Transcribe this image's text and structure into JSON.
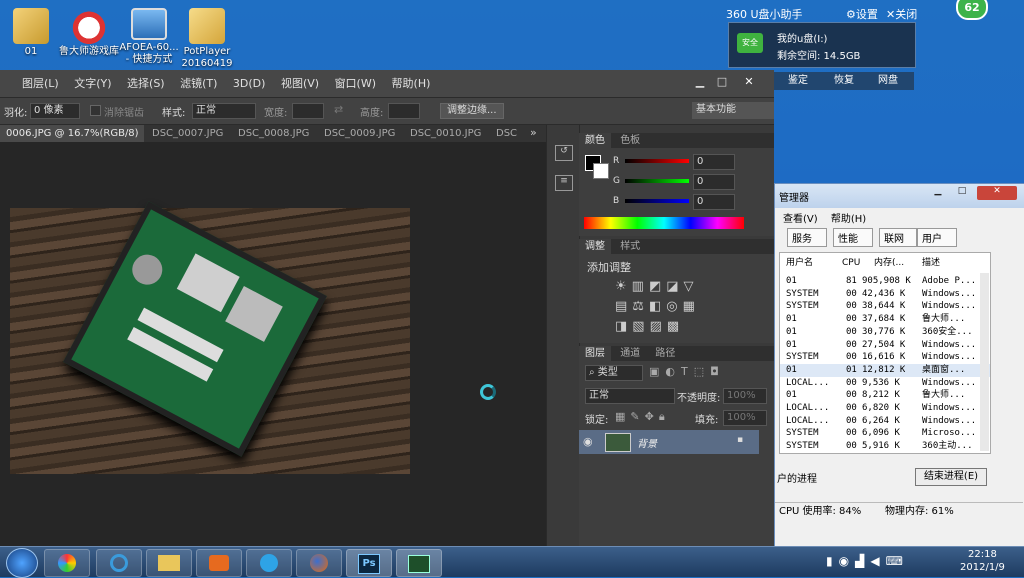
{
  "desktop": {
    "icons": [
      {
        "label": "01",
        "icon": "user-folder-icon"
      },
      {
        "label": "鲁大师游戏库",
        "icon": "gamepad-icon"
      },
      {
        "label": "AFOEA-60... - 快捷方式",
        "icon": "monitor-shortcut-icon"
      },
      {
        "label": "PotPlayer 20160419",
        "icon": "folder-icon"
      }
    ]
  },
  "widget360": {
    "title": "360 U盘小助手",
    "settings": "设置",
    "close": "关闭",
    "badge": "62",
    "safe": "安全",
    "drive_name": "我的u盘(I:)",
    "free_space": "剩余空间: 14.5GB",
    "actions": [
      "鉴定",
      "恢复",
      "网盘"
    ]
  },
  "photoshop": {
    "menu": [
      "图层(L)",
      "文字(Y)",
      "选择(S)",
      "滤镜(T)",
      "3D(D)",
      "视图(V)",
      "窗口(W)",
      "帮助(H)"
    ],
    "options": {
      "feather_label": "羽化:",
      "feather_value": "0 像素",
      "antialias": "消除锯齿",
      "style_label": "样式:",
      "style_value": "正常",
      "width_label": "宽度:",
      "height_label": "高度:",
      "refine_edge": "调整边缘...",
      "workspace": "基本功能"
    },
    "doc_tabs": [
      "0006.JPG @ 16.7%(RGB/8) *",
      "DSC_0007.JPG",
      "DSC_0008.JPG",
      "DSC_0009.JPG",
      "DSC_0010.JPG",
      "DSC"
    ],
    "color_panel": {
      "tabs": [
        "颜色",
        "色板"
      ],
      "r_label": "R",
      "g_label": "G",
      "b_label": "B",
      "r": "0",
      "g": "0",
      "b": "0"
    },
    "adjust_panel": {
      "tabs": [
        "调整",
        "样式"
      ],
      "title": "添加调整"
    },
    "layers_panel": {
      "tabs": [
        "图层",
        "通道",
        "路径"
      ],
      "kind": "类型",
      "blend": "正常",
      "opacity_label": "不透明度:",
      "opacity_value": "100%",
      "lock_label": "锁定:",
      "fill_label": "填充:",
      "fill_value": "100%",
      "layer_name": "背景"
    }
  },
  "taskmgr": {
    "title": "管理器",
    "menu": [
      "查看(V)",
      "帮助(H)"
    ],
    "tabs": [
      "服务",
      "性能",
      "联网",
      "用户"
    ],
    "columns": [
      "用户名",
      "CPU",
      "内存(...",
      "描述"
    ],
    "rows": [
      [
        "01",
        "81",
        "905,908 K",
        "Adobe P..."
      ],
      [
        "SYSTEM",
        "00",
        "42,436 K",
        "Windows..."
      ],
      [
        "SYSTEM",
        "00",
        "38,644 K",
        "Windows..."
      ],
      [
        "01",
        "00",
        "37,684 K",
        "鲁大师..."
      ],
      [
        "01",
        "00",
        "30,776 K",
        "360安全..."
      ],
      [
        "01",
        "00",
        "27,504 K",
        "Windows..."
      ],
      [
        "SYSTEM",
        "00",
        "16,616 K",
        "Windows..."
      ],
      [
        "01",
        "01",
        "12,812 K",
        "桌面窗..."
      ],
      [
        "LOCAL...",
        "00",
        "9,536 K",
        "Windows..."
      ],
      [
        "01",
        "00",
        "8,212 K",
        "鲁大师..."
      ],
      [
        "LOCAL...",
        "00",
        "6,820 K",
        "Windows..."
      ],
      [
        "LOCAL...",
        "00",
        "6,264 K",
        "Windows..."
      ],
      [
        "SYSTEM",
        "00",
        "6,096 K",
        "Microso..."
      ],
      [
        "SYSTEM",
        "00",
        "5,916 K",
        "360主动..."
      ]
    ],
    "all_users": "户的进程",
    "end_process": "结束进程(E)",
    "status_cpu": "CPU 使用率: 84%",
    "status_mem": "物理内存: 61%"
  },
  "taskbar": {
    "time": "22:18",
    "date": "2012/1/9",
    "ps_label": "Ps"
  }
}
